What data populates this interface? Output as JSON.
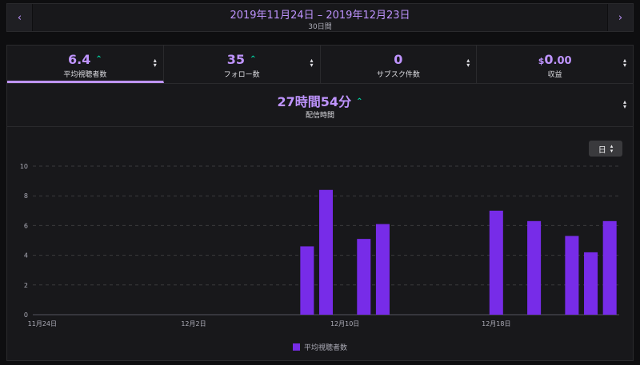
{
  "header": {
    "prev_icon": "‹",
    "next_icon": "›",
    "date_range": "2019年11月24日 – 2019年12月23日",
    "period": "30日間"
  },
  "stats": [
    {
      "value": "6.4",
      "label": "平均視聴者数",
      "trend": "up",
      "active": true
    },
    {
      "value": "35",
      "label": "フォロー数",
      "trend": "up",
      "active": false
    },
    {
      "value": "0",
      "label": "サブスク件数",
      "trend": null,
      "active": false
    },
    {
      "value_currency": "$",
      "value_int": "0",
      "value_dec": ".00",
      "label": "収益",
      "trend": null,
      "active": false
    }
  ],
  "stream_time": {
    "value": "27時間54分",
    "label": "配信時間",
    "trend": "up"
  },
  "unit_selector": {
    "label": "日",
    "icon": "sort-icon"
  },
  "trend_glyph": "⌃",
  "sort_glyph_up": "▴",
  "sort_glyph_down": "▾",
  "colors": {
    "accent": "#bf94ff",
    "bar": "#772ce8",
    "trend_up": "#00d6a3",
    "grid": "#3a3a3d"
  },
  "chart_data": {
    "type": "bar",
    "start_date": "2019-11-24",
    "days": 30,
    "x_tick_labels": [
      "11月24日",
      "12月2日",
      "12月10日",
      "12月18日"
    ],
    "x_tick_day_index": [
      0,
      8,
      16,
      24
    ],
    "ylim": [
      0,
      10
    ],
    "y_ticks": [
      0,
      2,
      4,
      6,
      8,
      10
    ],
    "grid": true,
    "legend_position": "bottom",
    "series": [
      {
        "name": "平均視聴者数",
        "values": [
          0,
          0,
          0,
          0,
          0,
          0,
          0,
          0,
          0,
          0,
          0,
          0,
          0,
          0,
          4.6,
          8.4,
          0,
          5.1,
          6.1,
          0,
          0,
          0,
          0,
          0,
          7.0,
          0,
          6.3,
          0,
          5.3,
          4.2,
          6.3
        ]
      }
    ]
  }
}
